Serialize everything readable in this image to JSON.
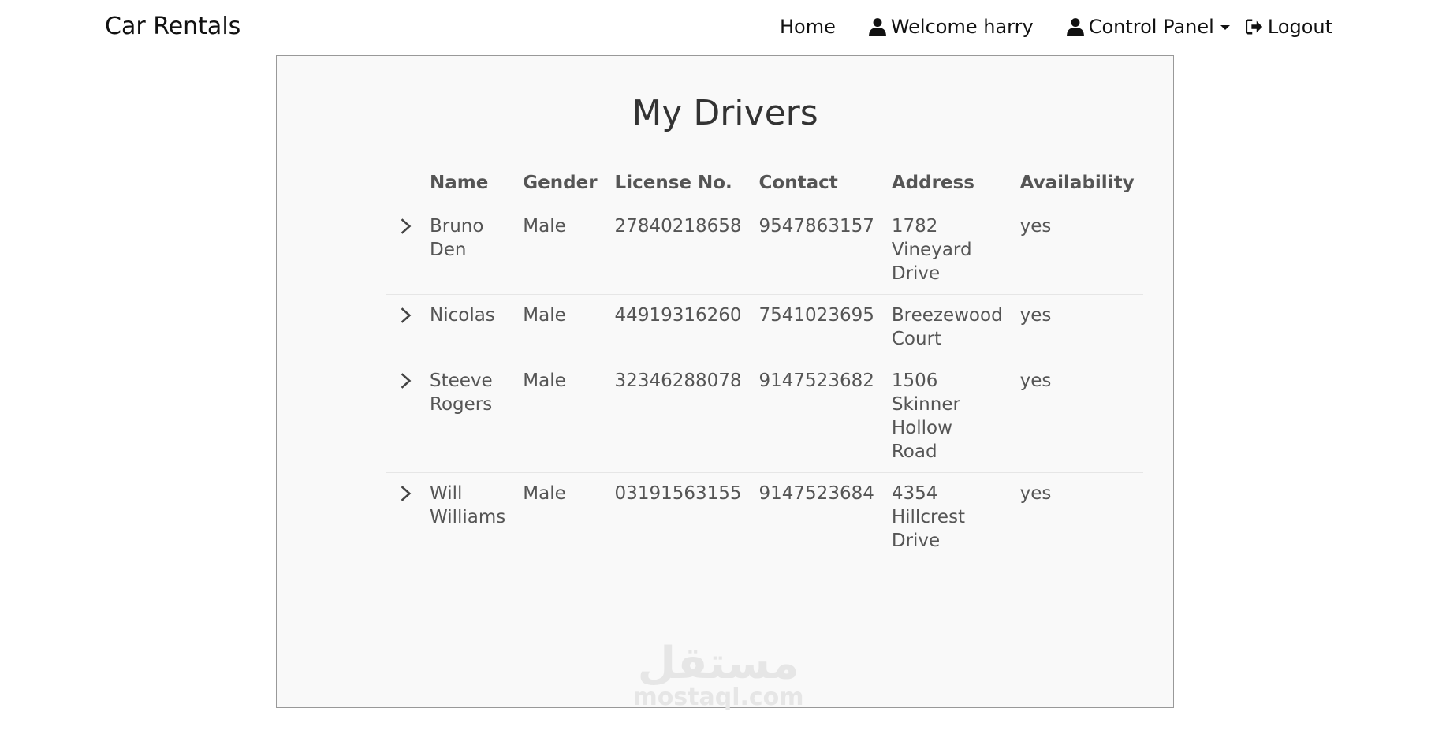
{
  "navbar": {
    "brand": "Car Rentals",
    "home": "Home",
    "welcome": "Welcome harry",
    "control_panel": "Control Panel",
    "logout": "Logout"
  },
  "page": {
    "title": "My Drivers"
  },
  "table": {
    "headers": [
      "",
      "Name",
      "Gender",
      "License No.",
      "Contact",
      "Address",
      "Availability"
    ],
    "rows": [
      {
        "name": "Bruno Den",
        "gender": "Male",
        "license": "27840218658",
        "contact": "9547863157",
        "address": "1782 Vineyard Drive",
        "availability": "yes"
      },
      {
        "name": "Nicolas",
        "gender": "Male",
        "license": "44919316260",
        "contact": "7541023695",
        "address": "Breezewood Court",
        "availability": "yes"
      },
      {
        "name": "Steeve Rogers",
        "gender": "Male",
        "license": "32346288078",
        "contact": "9147523682",
        "address": "1506 Skinner Hollow Road",
        "availability": "yes"
      },
      {
        "name": "Will Williams",
        "gender": "Male",
        "license": "03191563155",
        "contact": "9147523684",
        "address": "4354 Hillcrest Drive",
        "availability": "yes"
      }
    ]
  },
  "watermark": {
    "arabic": "مستقل",
    "latin": "mostaql.com"
  },
  "icons": {
    "user": "user-icon",
    "logout": "logout-icon",
    "caret": "caret-down-icon",
    "expand": "chevron-right-icon"
  }
}
